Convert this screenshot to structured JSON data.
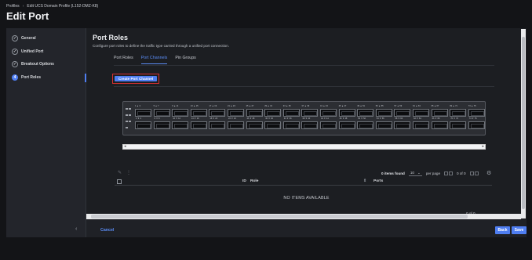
{
  "breadcrumb": {
    "root": "Profiles",
    "separator": "›",
    "current": "Edit UCS Domain Profile (L152-DMZ-K8)"
  },
  "page_title": "Edit Port",
  "wizard": {
    "steps": [
      {
        "label": "General",
        "state": "complete",
        "marker": "✓"
      },
      {
        "label": "Unified Port",
        "state": "complete",
        "marker": "✓"
      },
      {
        "label": "Breakout Options",
        "state": "complete",
        "marker": "✓"
      },
      {
        "label": "Port Roles",
        "state": "current",
        "marker": "4"
      }
    ],
    "collapse_icon": "‹"
  },
  "content": {
    "heading": "Port Roles",
    "description": "Configure port roles to define the traffic type carried through a unified port connection.",
    "tabs": [
      {
        "label": "Port Roles",
        "active": false
      },
      {
        "label": "Port Channels",
        "active": true
      },
      {
        "label": "Pin Groups",
        "active": false
      }
    ],
    "create_button": "Create Port Channel"
  },
  "switch": {
    "group_labels": [
      "1 ▲ 3",
      "5 ▲ 7",
      "9 ▲ 11",
      "13 ▲ 15",
      "17 ▲ 19",
      "21 ▲ 23",
      "25 ▲ 27",
      "29 ▲ 31",
      "33 ▲ 35",
      "37 ▲ 39",
      "41 ▲ 43",
      "45 ▲ 47",
      "49 ▲ 51",
      "53 ▲ 55",
      "57 ▲ 59",
      "61 ▲ 63",
      "65 ▲ 67",
      "69 ▲ 71",
      "73 ▲ 75"
    ],
    "mid_labels": [
      "2 ▼ 4",
      "6 ▼ 8",
      "10 ▼ 12",
      "14 ▼ 16",
      "18 ▼ 20",
      "22 ▼ 24",
      "26 ▼ 28",
      "30 ▼ 32",
      "34 ▼ 36",
      "38 ▼ 40",
      "42 ▼ 44",
      "46 ▼ 48",
      "50 ▼ 52",
      "54 ▼ 56",
      "58 ▼ 60",
      "62 ▼ 64",
      "66 ▼ 68",
      "70 ▼ 72",
      "74 ▼ 76"
    ]
  },
  "table": {
    "items_found": "0 items found",
    "per_page_value": "10",
    "per_page_label": "per page",
    "page_indicator": "0 of 0",
    "columns": {
      "id": "ID",
      "role": "Role",
      "ports": "Ports"
    },
    "empty_message": "NO ITEMS AVAILABLE",
    "bottom_page_indicator": "0 of 0"
  },
  "footer": {
    "cancel": "Cancel",
    "back": "Back",
    "save": "Save"
  },
  "colors": {
    "accent": "#4f7ef1",
    "highlight": "#d32f2f",
    "background": "#131417"
  }
}
